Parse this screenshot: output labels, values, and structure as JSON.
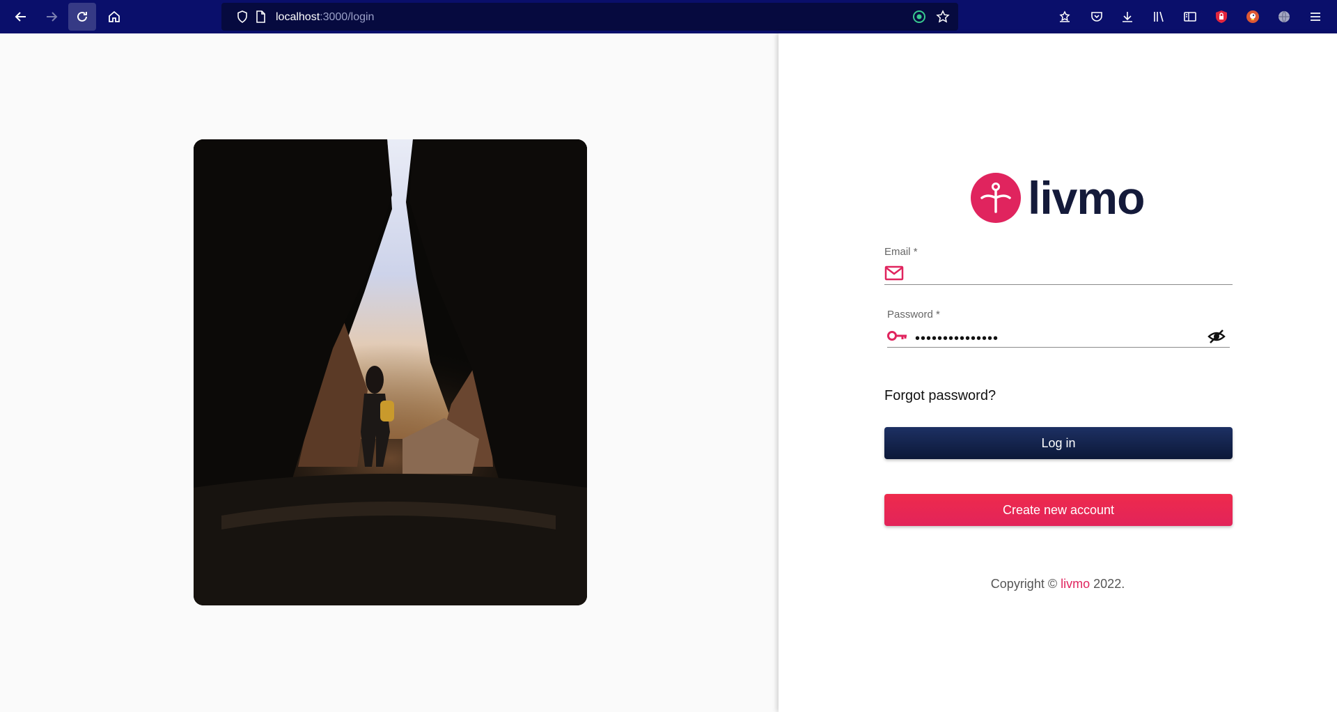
{
  "browser": {
    "url_host": "localhost",
    "url_path": ":3000/login",
    "icons": [
      "back-arrow-icon",
      "forward-arrow-icon",
      "reload-icon",
      "home-icon",
      "shield-icon",
      "page-icon",
      "extension-icon",
      "bookmark-star-icon",
      "collections-icon",
      "pocket-icon",
      "download-icon",
      "library-icon",
      "sidebar-icon",
      "lock-extension-icon",
      "duckduckgo-icon",
      "globe-icon",
      "menu-icon"
    ]
  },
  "brand": {
    "name": "livmo",
    "accent": "#e0245e",
    "dark": "#141a3a"
  },
  "login": {
    "email_label": "Email",
    "email_value": "",
    "password_label": "Password",
    "password_value": "•••••••••••••••",
    "required_mark": "*",
    "forgot_label": "Forgot password?",
    "login_button": "Log in",
    "create_button": "Create new account"
  },
  "footer": {
    "copyright_prefix": "Copyright ©",
    "brand": "livmo",
    "year": "2022."
  },
  "colors": {
    "toolbar": "#0a0f6b",
    "login_button": "#152650",
    "create_button": "#e8284f"
  }
}
